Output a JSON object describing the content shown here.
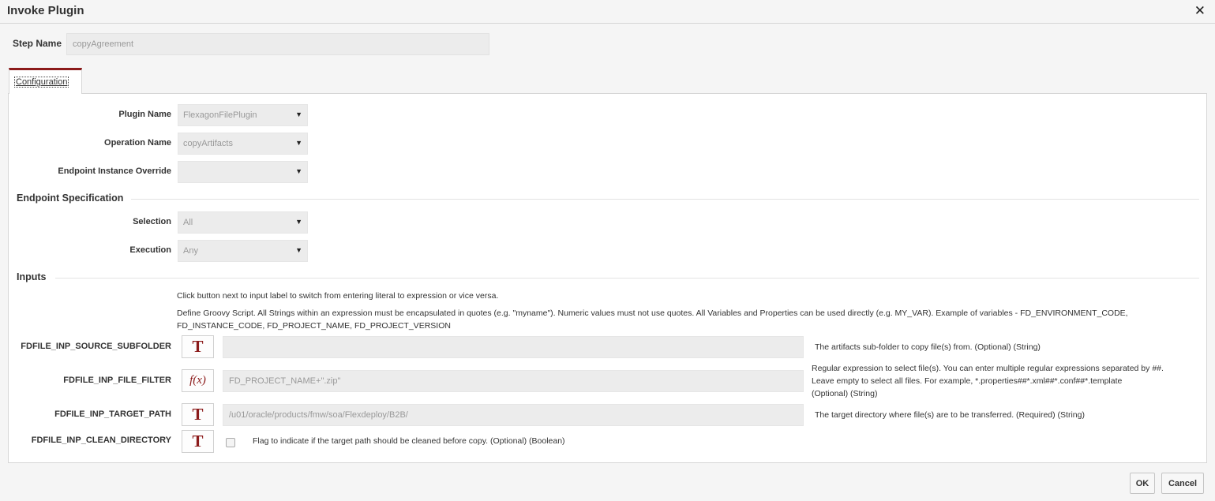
{
  "dialog": {
    "title": "Invoke Plugin",
    "close_icon": "close-icon"
  },
  "step": {
    "label": "Step Name",
    "value": "copyAgreement"
  },
  "tabs": [
    {
      "label": "Configuration",
      "active": true
    }
  ],
  "config": {
    "plugin_name": {
      "label": "Plugin Name",
      "value": "FlexagonFilePlugin"
    },
    "operation_name": {
      "label": "Operation Name",
      "value": "copyArtifacts"
    },
    "endpoint_override": {
      "label": "Endpoint Instance Override",
      "value": ""
    }
  },
  "endpoint_spec": {
    "title": "Endpoint Specification",
    "selection": {
      "label": "Selection",
      "value": "All"
    },
    "execution": {
      "label": "Execution",
      "value": "Any"
    }
  },
  "inputs": {
    "title": "Inputs",
    "help_switch": "Click button next to input label to switch from entering literal to expression or vice versa.",
    "help_groovy_1": "Define Groovy Script. All Strings within an expression must be encapsulated in quotes (e.g. \"myname\"). Numeric values must not use quotes. All Variables and Properties can be used directly (e.g. MY_VAR). Example of variables - FD_ENVIRONMENT_CODE,",
    "help_groovy_2": "FD_INSTANCE_CODE, FD_PROJECT_NAME, FD_PROJECT_VERSION",
    "rows": [
      {
        "label": "FDFILE_INP_SOURCE_SUBFOLDER",
        "mode": "T",
        "value": "",
        "desc_1": "The artifacts sub-folder to copy file(s) from. (Optional) (String)"
      },
      {
        "label": "FDFILE_INP_FILE_FILTER",
        "mode": "f(x)",
        "value": "FD_PROJECT_NAME+\".zip\"",
        "desc_1": "Regular expression to select file(s). You can enter multiple regular expressions separated by ##.",
        "desc_2": "Leave empty to select all files. For example, *.properties##*.xml##*.conf##*.template",
        "desc_3": "(Optional) (String)"
      },
      {
        "label": "FDFILE_INP_TARGET_PATH",
        "mode": "T",
        "value": "/u01/oracle/products/fmw/soa/Flexdeploy/B2B/",
        "desc_1": "The target directory where file(s) are to be transferred. (Required) (String)"
      },
      {
        "label": "FDFILE_INP_CLEAN_DIRECTORY",
        "mode": "T",
        "checked": false,
        "check_label": "Flag to indicate if the target path should be cleaned before copy. (Optional) (Boolean)"
      }
    ]
  },
  "footer": {
    "ok_label": "OK",
    "cancel_label": "Cancel"
  },
  "colors": {
    "accent": "#8b1a1a",
    "field_bg": "#ececec",
    "page_bg": "#f5f5f5"
  }
}
